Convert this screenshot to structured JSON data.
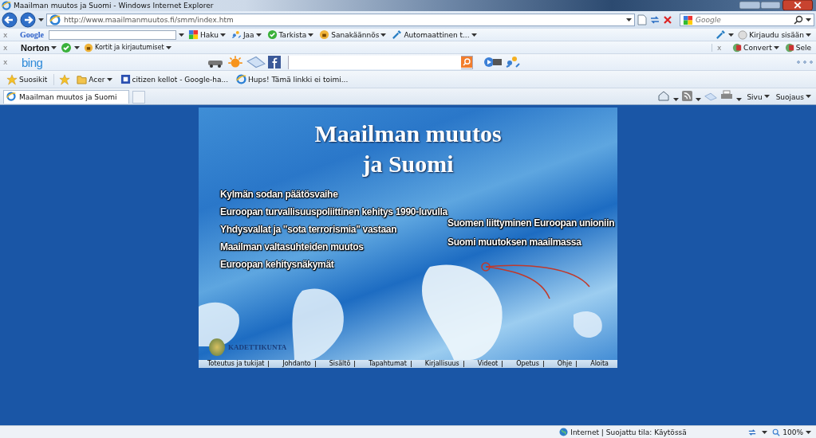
{
  "window": {
    "title": "Maailman muutos ja Suomi - Windows Internet Explorer"
  },
  "address_bar": {
    "url": "http://www.maailmanmuutos.fi/smm/index.htm",
    "search_placeholder": "Google"
  },
  "google_toolbar": {
    "close": "x",
    "logo": "Google",
    "items": [
      {
        "label": "Haku",
        "kind": "menu"
      },
      {
        "label": "Jaa",
        "kind": "menu"
      },
      {
        "label": "Tarkista",
        "kind": "menu"
      },
      {
        "label": "Sanakäännös",
        "kind": "menu"
      },
      {
        "label": "Automaattinen t...",
        "kind": "menu"
      }
    ],
    "sign_in": "Kirjaudu sisään"
  },
  "norton_toolbar": {
    "close": "x",
    "logo": "Norton",
    "cards": "Kortit ja kirjautumiset",
    "close_right": "x",
    "convert": "Convert",
    "select": "Sele"
  },
  "bing_toolbar": {
    "close": "x",
    "logo": "bing"
  },
  "favorites_bar": {
    "favorites": "Suosikit",
    "links": [
      {
        "label": "Acer",
        "kind": "folder"
      },
      {
        "label": "citizen kellot - Google-ha...",
        "kind": "page"
      },
      {
        "label": "Hups! Tämä linkki ei toimi...",
        "kind": "ie"
      }
    ]
  },
  "tabs": [
    {
      "label": "Maailman muutos ja Suomi",
      "selected": true
    }
  ],
  "command_bar": {
    "items": [
      "Sivu",
      "Suojaus"
    ]
  },
  "page": {
    "title_lines": [
      "Maailman muutos",
      "ja Suomi"
    ],
    "topics_left": [
      "Kylmän sodan päätösvaihe",
      "Euroopan turvallisuuspoliittinen kehitys 1990-luvulla",
      "Yhdysvallat ja \"sota terrorismia\" vastaan",
      "Maailman valtasuhteiden muutos",
      "Euroopan kehitysnäkymät"
    ],
    "topics_right": [
      "Suomen liittyminen Euroopan unioniin",
      "Suomi muutoksen maailmassa"
    ],
    "logo_text": "KADETTIKUNTA",
    "nav": [
      "Toteutus ja tukijat",
      "Johdanto",
      "Sisältö",
      "Tapahtumat",
      "Kirjallisuus",
      "Videot",
      "Opetus",
      "Ohje",
      "Aloita"
    ]
  },
  "status_bar": {
    "zone": "Internet | Suojattu tila: Käytössä",
    "zoom": "100%"
  }
}
